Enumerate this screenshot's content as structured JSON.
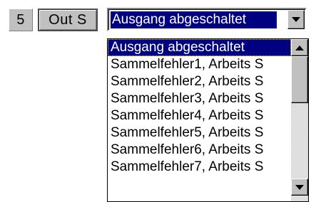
{
  "row": {
    "number": "5",
    "signal": "Out  S"
  },
  "combo": {
    "value": "Ausgang abgeschaltet"
  },
  "dropdown": {
    "selected_index": 0,
    "options": [
      "Ausgang abgeschaltet",
      "Sammelfehler1, Arbeits S",
      "Sammelfehler2, Arbeits S",
      "Sammelfehler3, Arbeits S",
      "Sammelfehler4, Arbeits S",
      "Sammelfehler5, Arbeits S",
      "Sammelfehler6, Arbeits S",
      "Sammelfehler7, Arbeits S"
    ]
  },
  "icons": {
    "combo_button": "chevron-down-icon",
    "scroll_up": "scroll-up-arrow-icon",
    "scroll_down": "scroll-down-arrow-icon"
  },
  "colors": {
    "selection_bg": "#000080",
    "selection_fg": "#ffffff",
    "face": "#c0c0c0"
  }
}
